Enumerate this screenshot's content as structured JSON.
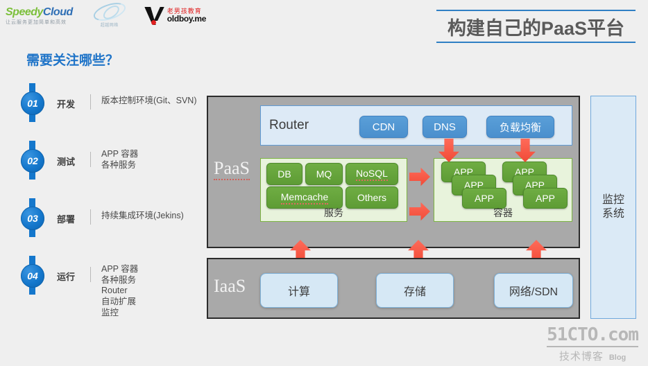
{
  "logos": {
    "speedycloud": {
      "name": "SpeedyCloud",
      "brand_a": "Speedy",
      "brand_b": "Cloud",
      "tagline": "让云服务更加简单和高效"
    },
    "swirl": {
      "name": "swirl-logo",
      "caption": "超越网络"
    },
    "oldboy": {
      "cn": "老男孩教育",
      "en": "oldboy.me"
    }
  },
  "header": {
    "title": "构建自己的PaaS平台",
    "accent_color": "#2f7fc4"
  },
  "sidebar": {
    "heading": "需要关注哪些？",
    "heading_color": "#1f74c8",
    "steps": [
      {
        "num": "01",
        "name": "开发",
        "detail": "版本控制环境(Git、SVN)"
      },
      {
        "num": "02",
        "name": "测试",
        "detail": "APP 容器\n各种服务"
      },
      {
        "num": "03",
        "name": "部署",
        "detail": "持续集成环境(Jekins)"
      },
      {
        "num": "04",
        "name": "运行",
        "detail": "APP 容器\n各种服务\nRouter\n自动扩展\n监控"
      }
    ]
  },
  "diagram": {
    "paas": {
      "label": "PaaS",
      "router": {
        "label": "Router",
        "pills": [
          {
            "label": "CDN"
          },
          {
            "label": "DNS"
          },
          {
            "label": "负载均衡"
          }
        ]
      },
      "services": {
        "caption": "服务",
        "items": [
          {
            "label": "DB"
          },
          {
            "label": "MQ"
          },
          {
            "label": "NoSQL"
          },
          {
            "label": "Memcache"
          },
          {
            "label": "Others"
          }
        ]
      },
      "containers": {
        "caption": "容器",
        "stacks": [
          {
            "apps": [
              "APP",
              "APP",
              "APP"
            ]
          },
          {
            "apps": [
              "APP",
              "APP",
              "APP"
            ]
          }
        ]
      }
    },
    "iaas": {
      "label": "IaaS",
      "items": [
        {
          "label": "计算"
        },
        {
          "label": "存储"
        },
        {
          "label": "网络/SDN"
        }
      ]
    },
    "monitor": {
      "label": "监控\n系统"
    },
    "arrow_color": "#f04a36"
  },
  "watermark": {
    "site": "51CTO.com",
    "cn": "技术博客",
    "en": "Blog"
  }
}
